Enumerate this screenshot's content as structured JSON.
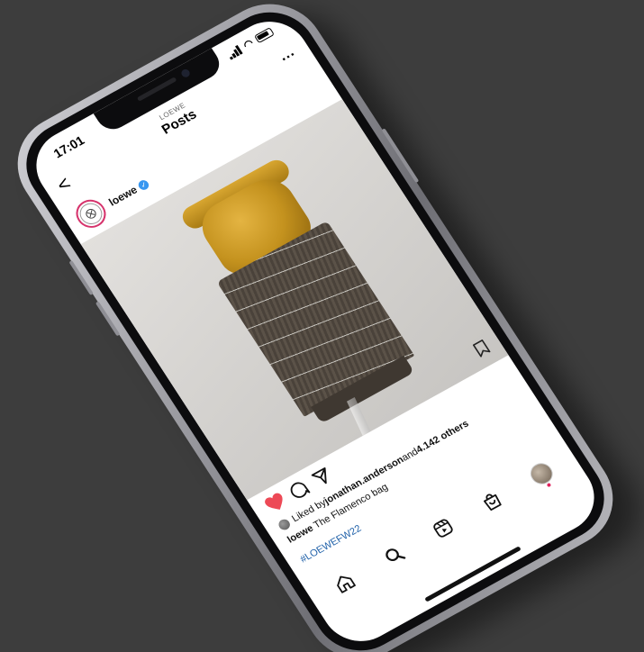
{
  "status_bar": {
    "time": "17:01"
  },
  "header": {
    "back_glyph": "<",
    "account": "LOEWE",
    "title": "Posts",
    "more_glyph": "..."
  },
  "post": {
    "avatar_icon": "loewe-logo",
    "username": "loewe",
    "verified": true,
    "image_description_icon": "post-photo",
    "liked": true,
    "likes_prefix": "Liked by ",
    "likes_user": "jonathan.anderson",
    "likes_mid": " and ",
    "likes_count": "4.142 others",
    "caption_user": "loewe",
    "caption_text": " The Flamenco bag",
    "hashtag": "#LOEWEFW22"
  },
  "tabs": [
    "home",
    "search",
    "reels",
    "shop",
    "profile"
  ],
  "colors": {
    "background": "#3d3d3d",
    "heart": "#ed4956",
    "hashtag": "#1d5fa8",
    "verified": "#3897f0",
    "story_ring": "#d6336c"
  }
}
